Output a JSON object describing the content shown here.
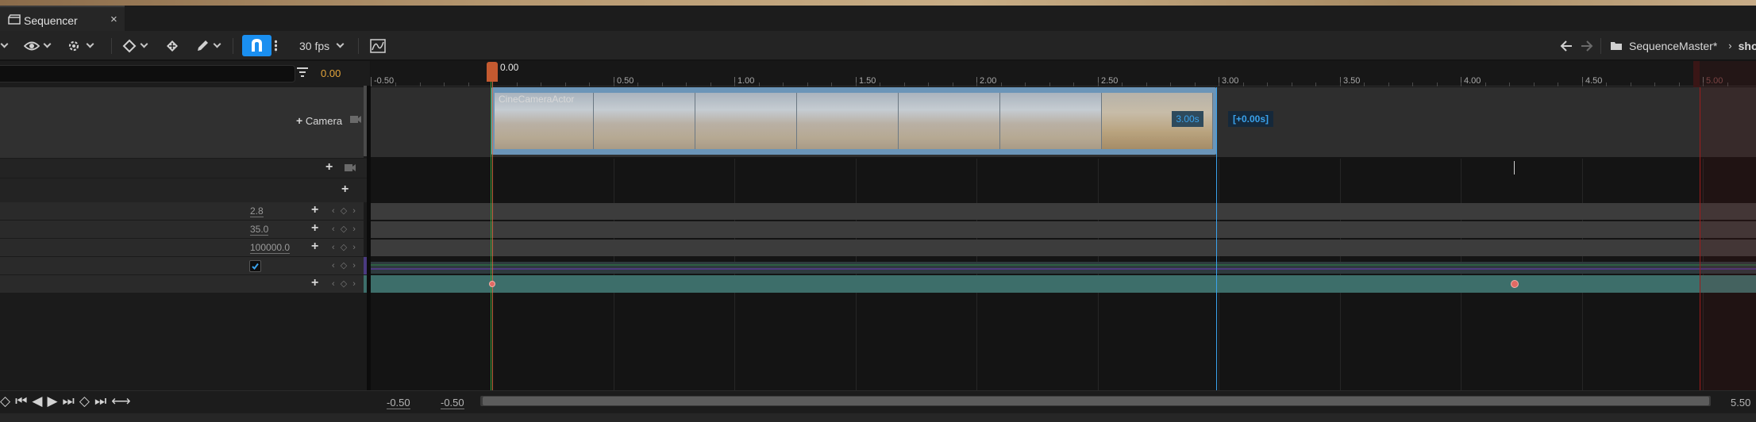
{
  "tab": {
    "title": "Sequencer",
    "close": "×"
  },
  "toolbar": {
    "fps": "30 fps",
    "breadcrumb_sequence": "SequenceMaster*",
    "breadcrumb_shot": "sho",
    "icons": [
      "eye-icon",
      "gear-icon",
      "keyframe-icon",
      "keyframe-add-icon",
      "pencil-icon",
      "magnet-icon",
      "curve-editor-icon",
      "back-arrow-icon",
      "forward-arrow-icon",
      "folder-icon"
    ]
  },
  "left_panel": {
    "current_time": "0.00",
    "camera_add_label": "Camera",
    "properties": [
      {
        "value": "2.8"
      },
      {
        "value": "35.0"
      },
      {
        "value": "100000.0"
      },
      {
        "checked": true
      }
    ],
    "key_nav": "‹ ◇ ›"
  },
  "timeline": {
    "playhead_time": "0.00",
    "ruler_ticks": [
      "-0.50",
      "0.50",
      "1.00",
      "1.50",
      "2.00",
      "2.50",
      "3.00",
      "3.50",
      "4.00",
      "4.50",
      "5.00"
    ],
    "section_name": "CineCameraActor",
    "section_duration": "3.00s",
    "section_offset": "[+0.00s]",
    "colors": {
      "playhead": "#c45a30",
      "selection": "#3aa2ec",
      "end_marker": "#9e1c1c",
      "accent": "#1a8ff0"
    }
  },
  "bottom": {
    "view_start": "-0.50",
    "working_start": "-0.50",
    "view_end": "5.50"
  }
}
